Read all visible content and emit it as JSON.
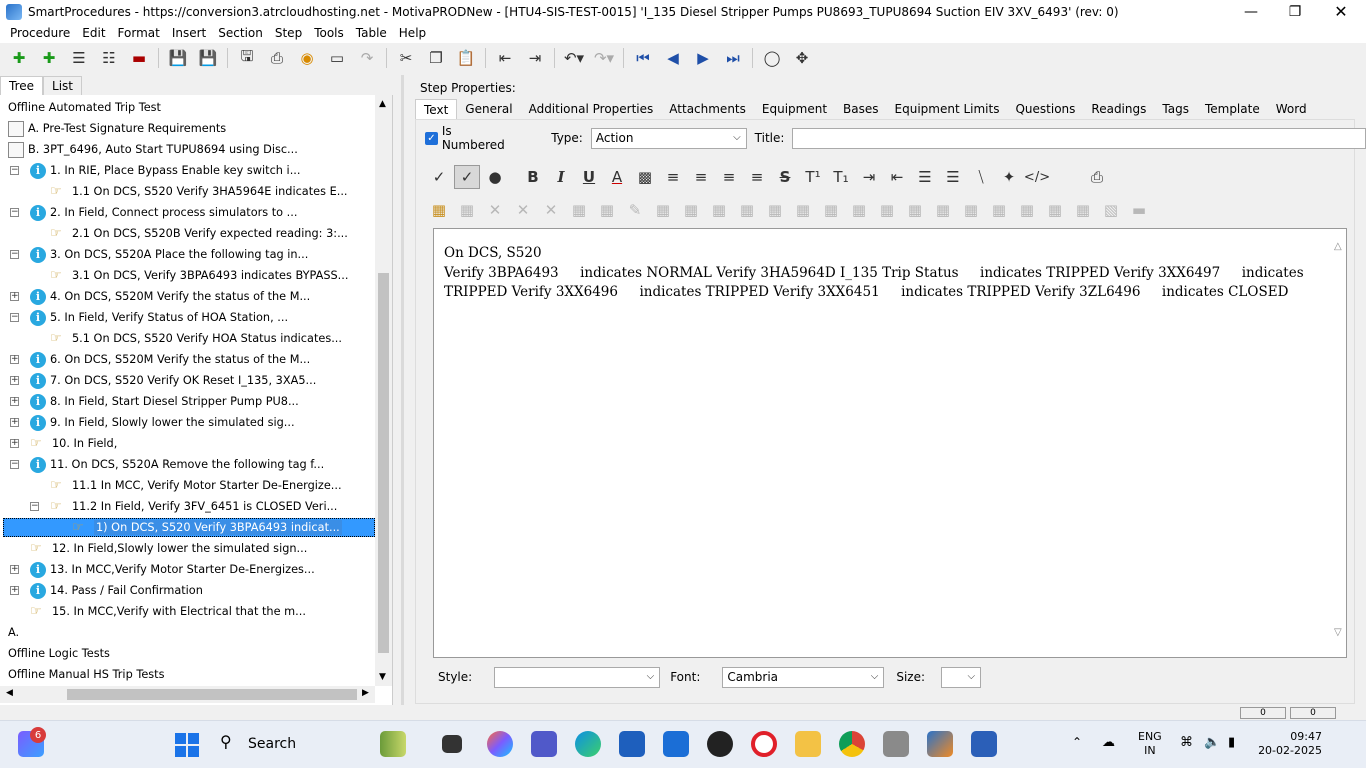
{
  "window": {
    "title": "SmartProcedures - https://conversion3.atrcloudhosting.net - MotivaPRODNew - [HTU4-SIS-TEST-0015] 'I_135 Diesel Stripper Pumps PU8693_TUPU8694 Suction EIV 3XV_6493' (rev: 0)"
  },
  "menu": [
    "Procedure",
    "Edit",
    "Format",
    "Insert",
    "Section",
    "Step",
    "Tools",
    "Table",
    "Help"
  ],
  "left_tabs": [
    "Tree",
    "List"
  ],
  "tree": [
    {
      "label": "Offline Automated Trip Test",
      "icon": "none"
    },
    {
      "label": "A. Pre-Test Signature Requirements",
      "icon": "doc"
    },
    {
      "label": "B. 3PT_6496, Auto Start TUPU8694 using Disc...",
      "icon": "doc"
    },
    {
      "label": "1. In RIE, Place Bypass Enable key switch i...",
      "icon": "info"
    },
    {
      "label": "1.1 On DCS, S520 Verify 3HA5964E indicates E...",
      "icon": "hand"
    },
    {
      "label": "2. In Field, Connect process simulators to ...",
      "icon": "info"
    },
    {
      "label": "2.1 On DCS, S520B Verify expected reading: 3:...",
      "icon": "hand"
    },
    {
      "label": "3. On DCS, S520A Place the following tag in...",
      "icon": "info"
    },
    {
      "label": "3.1 On DCS, Verify 3BPA6493 indicates BYPASS...",
      "icon": "hand"
    },
    {
      "label": "4. On DCS, S520M Verify the status of the M...",
      "icon": "info"
    },
    {
      "label": "5. In Field, Verify Status of HOA Station, ...",
      "icon": "info"
    },
    {
      "label": "5.1 On DCS, S520 Verify HOA Status indicates...",
      "icon": "hand"
    },
    {
      "label": "6. On DCS, S520M Verify the status of the M...",
      "icon": "info"
    },
    {
      "label": "7. On DCS, S520 Verify OK Reset I_135, 3XA5...",
      "icon": "info"
    },
    {
      "label": "8. In Field, Start Diesel Stripper Pump PU8...",
      "icon": "info"
    },
    {
      "label": "9. In Field, Slowly lower the simulated sig...",
      "icon": "info"
    },
    {
      "label": "10. In Field,",
      "icon": "hand"
    },
    {
      "label": "11. On DCS, S520A Remove the following tag f...",
      "icon": "info"
    },
    {
      "label": "11.1 In MCC, Verify Motor Starter De-Energize...",
      "icon": "hand"
    },
    {
      "label": "11.2 In Field, Verify 3FV_6451 is CLOSED Veri...",
      "icon": "hand"
    },
    {
      "label": "1) On DCS, S520 Verify 3BPA6493     indicat...",
      "icon": "hand"
    },
    {
      "label": "12. In Field,Slowly lower the simulated sign...",
      "icon": "hand"
    },
    {
      "label": "13. In MCC,Verify Motor Starter De-Energizes...",
      "icon": "info"
    },
    {
      "label": "14. Pass / Fail Confirmation",
      "icon": "info"
    },
    {
      "label": "15. In MCC,Verify with Electrical that the m...",
      "icon": "hand"
    },
    {
      "label": "A.",
      "icon": "none"
    },
    {
      "label": "Offline Logic Tests",
      "icon": "none"
    },
    {
      "label": "Offline Manual HS Trip Tests",
      "icon": "none"
    }
  ],
  "step": {
    "header": "Step Properties:",
    "tabs": [
      "Text",
      "General",
      "Additional Properties",
      "Attachments",
      "Equipment",
      "Bases",
      "Equipment Limits",
      "Questions",
      "Readings",
      "Tags",
      "Template",
      "Word"
    ],
    "is_numbered_label": "Is Numbered",
    "type_label": "Type:",
    "type_value": "Action",
    "title_label": "Title:",
    "title_value": "",
    "text_line1": "On DCS, S520",
    "text_line2": "Verify 3BPA6493     indicates NORMAL Verify 3HA5964D I_135 Trip Status     indicates TRIPPED Verify 3XX6497     indicates TRIPPED Verify 3XX6496     indicates TRIPPED Verify 3XX6451     indicates TRIPPED Verify 3ZL6496     indicates CLOSED",
    "style_label": "Style:",
    "style_value": "",
    "font_label": "Font:",
    "font_value": "Cambria",
    "size_label": "Size:",
    "size_value": "",
    "status_values": [
      "0",
      "0"
    ]
  },
  "taskbar": {
    "search_label": "Search",
    "badge_count": "6",
    "lang": "ENG",
    "region": "IN",
    "time": "09:47",
    "date": "20-02-2025"
  }
}
